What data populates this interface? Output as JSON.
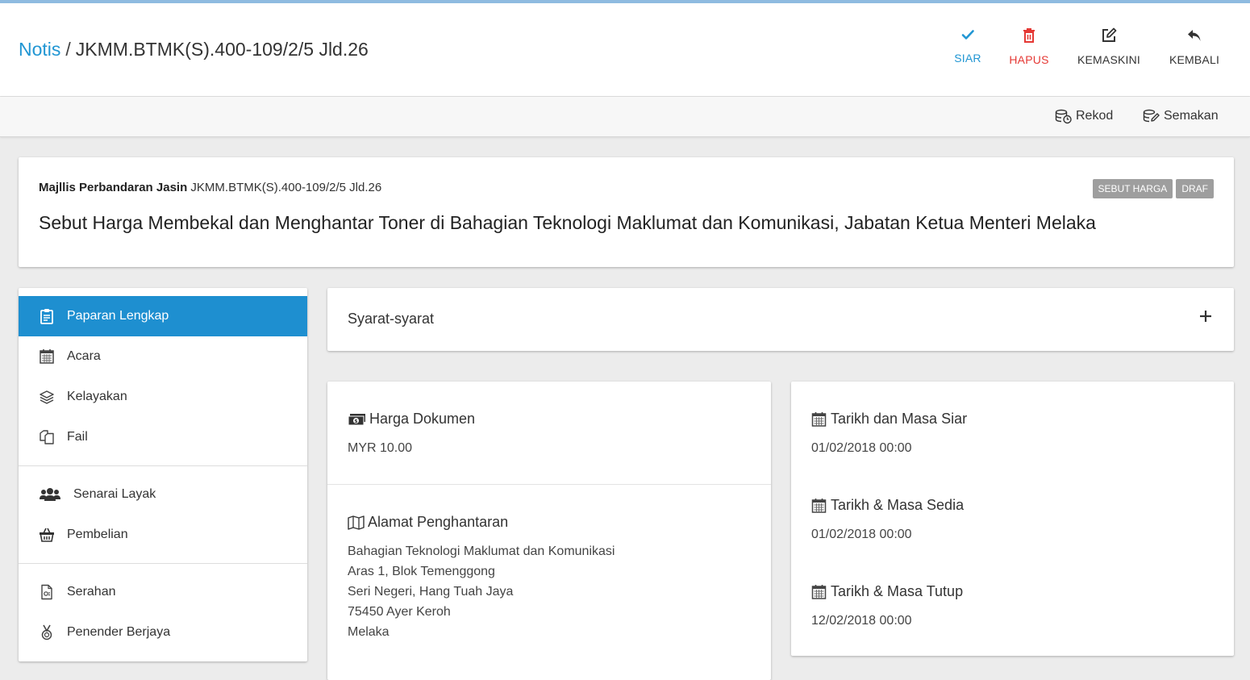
{
  "breadcrumb": {
    "link": "Notis",
    "separator": "/",
    "current": "JKMM.BTMK(S).400-109/2/5 Jld.26"
  },
  "actions": {
    "siar": {
      "label": "SIAR",
      "icon": "check-icon",
      "color": "#2196d3"
    },
    "hapus": {
      "label": "HAPUS",
      "icon": "trash-icon",
      "color": "#e53935"
    },
    "kemaskini": {
      "label": "KEMASKINI",
      "icon": "edit-icon"
    },
    "kembali": {
      "label": "KEMBALI",
      "icon": "reply-icon"
    }
  },
  "subbar": {
    "rekod": "Rekod",
    "semakan": "Semakan"
  },
  "summary": {
    "organization": "Majllis Perbandaran Jasin",
    "reference": "JKMM.BTMK(S).400-109/2/5 Jld.26",
    "title": "Sebut Harga Membekal dan Menghantar Toner di Bahagian Teknologi Maklumat dan Komunikasi, Jabatan Ketua Menteri Melaka",
    "badges": [
      "SEBUT HARGA",
      "DRAF"
    ]
  },
  "sidenav": {
    "active_color": "#1e8fd0",
    "items": [
      {
        "label": "Paparan Lengkap",
        "icon": "clipboard-icon"
      },
      {
        "label": "Acara",
        "icon": "calendar-icon"
      },
      {
        "label": "Kelayakan",
        "icon": "layers-icon"
      },
      {
        "label": "Fail",
        "icon": "files-icon"
      },
      {
        "label": "Senarai Layak",
        "icon": "users-icon"
      },
      {
        "label": "Pembelian",
        "icon": "basket-icon"
      },
      {
        "label": "Serahan",
        "icon": "document-icon"
      },
      {
        "label": "Penender Berjaya",
        "icon": "medal-icon"
      }
    ]
  },
  "syarat": {
    "label": "Syarat-syarat",
    "icon": "plus-icon"
  },
  "document": {
    "price_title": "Harga Dokumen",
    "price_value": "MYR 10.00",
    "address_title": "Alamat Penghantaran",
    "address_lines": [
      "Bahagian Teknologi Maklumat dan Komunikasi",
      "Aras 1, Blok Temenggong",
      "Seri Negeri, Hang Tuah Jaya",
      "75450 Ayer Keroh",
      "Melaka"
    ]
  },
  "dates": {
    "siar_title": "Tarikh dan Masa Siar",
    "siar_value": "01/02/2018 00:00",
    "sedia_title": "Tarikh & Masa Sedia",
    "sedia_value": "01/02/2018 00:00",
    "tutup_title": "Tarikh & Masa Tutup",
    "tutup_value": "12/02/2018 00:00"
  }
}
